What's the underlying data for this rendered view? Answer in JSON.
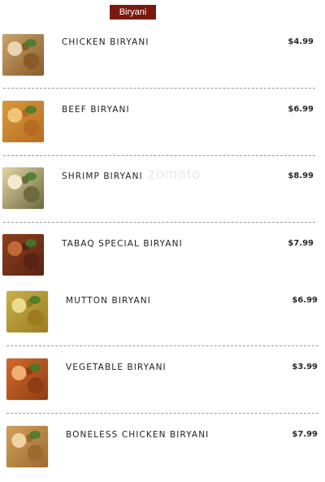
{
  "section": {
    "label": "Biryani"
  },
  "watermark": {
    "text": "zomato"
  },
  "items": [
    {
      "name": "CHICKEN BIRYANI",
      "price": "$4.99",
      "colors": [
        "#c9a46a",
        "#8a5a2b",
        "#e7d6b0"
      ]
    },
    {
      "name": "BEEF BIRYANI",
      "price": "$6.99",
      "colors": [
        "#d79a3a",
        "#b76b22",
        "#f0c676"
      ]
    },
    {
      "name": "SHRIMP BIRYANI",
      "price": "$8.99",
      "colors": [
        "#e3d3a4",
        "#6c6a3e",
        "#f3ead2"
      ]
    },
    {
      "name": "TABAQ SPECIAL BIRYANI",
      "price": "$7.99",
      "colors": [
        "#8c3f1d",
        "#5a2412",
        "#c06a35"
      ]
    },
    {
      "name": "MUTTON BIRYANI",
      "price": "$6.99",
      "colors": [
        "#c8b04a",
        "#9c7c1f",
        "#e9dc8c"
      ]
    },
    {
      "name": "VEGETABLE BIRYANI",
      "price": "$3.99",
      "colors": [
        "#d26a2a",
        "#8f3d14",
        "#efb073"
      ]
    },
    {
      "name": "BONELESS CHICKEN BIRYANI",
      "price": "$7.99",
      "colors": [
        "#d2a05a",
        "#9c6a2e",
        "#efd3a2"
      ]
    }
  ]
}
